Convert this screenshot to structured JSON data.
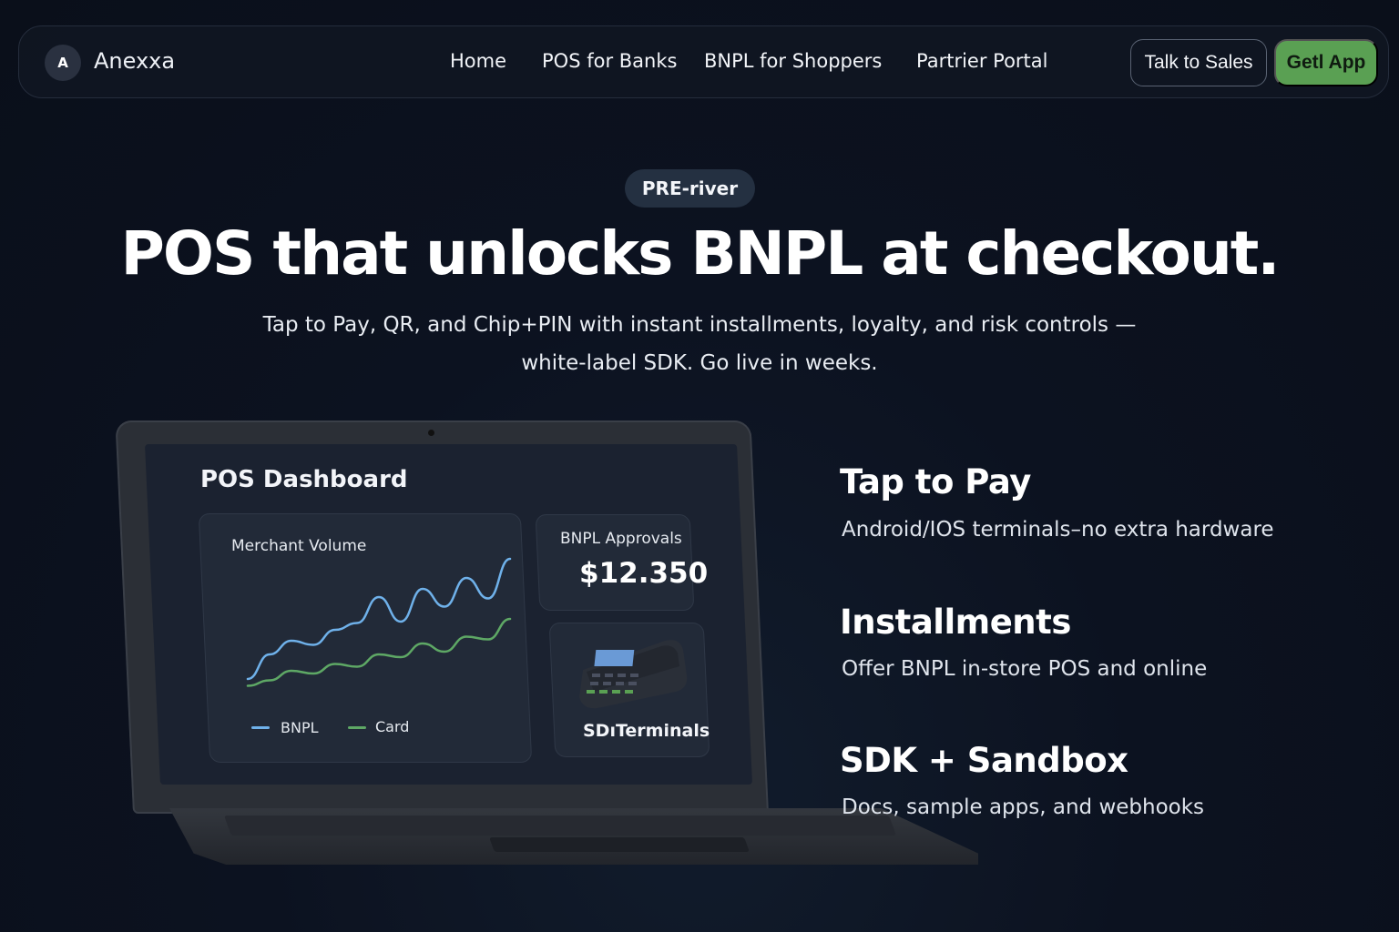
{
  "brand": {
    "logo_letter": "A",
    "name": "Anexxa"
  },
  "nav": {
    "links": [
      "Home",
      "POS for Banks",
      "BNPL for Shoppers",
      "Partrier Portal"
    ],
    "talk_to_sales": "Talk to Sales",
    "get_app": "Getl App"
  },
  "hero": {
    "badge": "PRE-river",
    "title": "POS that unlocks BNPL at checkout.",
    "subtitle_line1": "Tap to Pay, QR, and Chip+PIN with instant installments, loyalty, and risk controls —",
    "subtitle_line2": "white-label SDK. Go live in weeks."
  },
  "dashboard": {
    "title": "POS Dashboard",
    "volume_card": {
      "label": "Merchant Volume",
      "legend": [
        "BNPL",
        "Card"
      ]
    },
    "approvals_card": {
      "label": "BNPL Approvals",
      "value": "$12.350"
    },
    "terminals_card": {
      "label": "SDıTerminals",
      "icon": "pos-terminal-icon"
    }
  },
  "chart_data": {
    "type": "line",
    "title": "Merchant Volume",
    "x": [
      0,
      1,
      2,
      3,
      4,
      5,
      6,
      7,
      8,
      9,
      10,
      11,
      12
    ],
    "series": [
      {
        "name": "BNPL",
        "color": "#6fb1ea",
        "values": [
          8,
          26,
          36,
          33,
          44,
          49,
          68,
          50,
          74,
          61,
          82,
          67,
          96
        ]
      },
      {
        "name": "Card",
        "color": "#5ea865",
        "values": [
          3,
          7,
          14,
          12,
          19,
          17,
          26,
          24,
          34,
          28,
          39,
          37,
          52
        ]
      }
    ],
    "ylim": [
      0,
      100
    ],
    "grid": false,
    "legend": "bottom-left"
  },
  "features": [
    {
      "title": "Tap to Pay",
      "desc": "Android/IOS terminals–no extra hardware"
    },
    {
      "title": "Installments",
      "desc": "Offer BNPL in-store POS and online"
    },
    {
      "title": "SDK + Sandbox",
      "desc": "Docs, sample apps, and webhooks"
    }
  ],
  "colors": {
    "accent_green": "#5aa053",
    "background": "#0a0f1a",
    "series_bnpl": "#6fb1ea",
    "series_card": "#5ea865"
  }
}
